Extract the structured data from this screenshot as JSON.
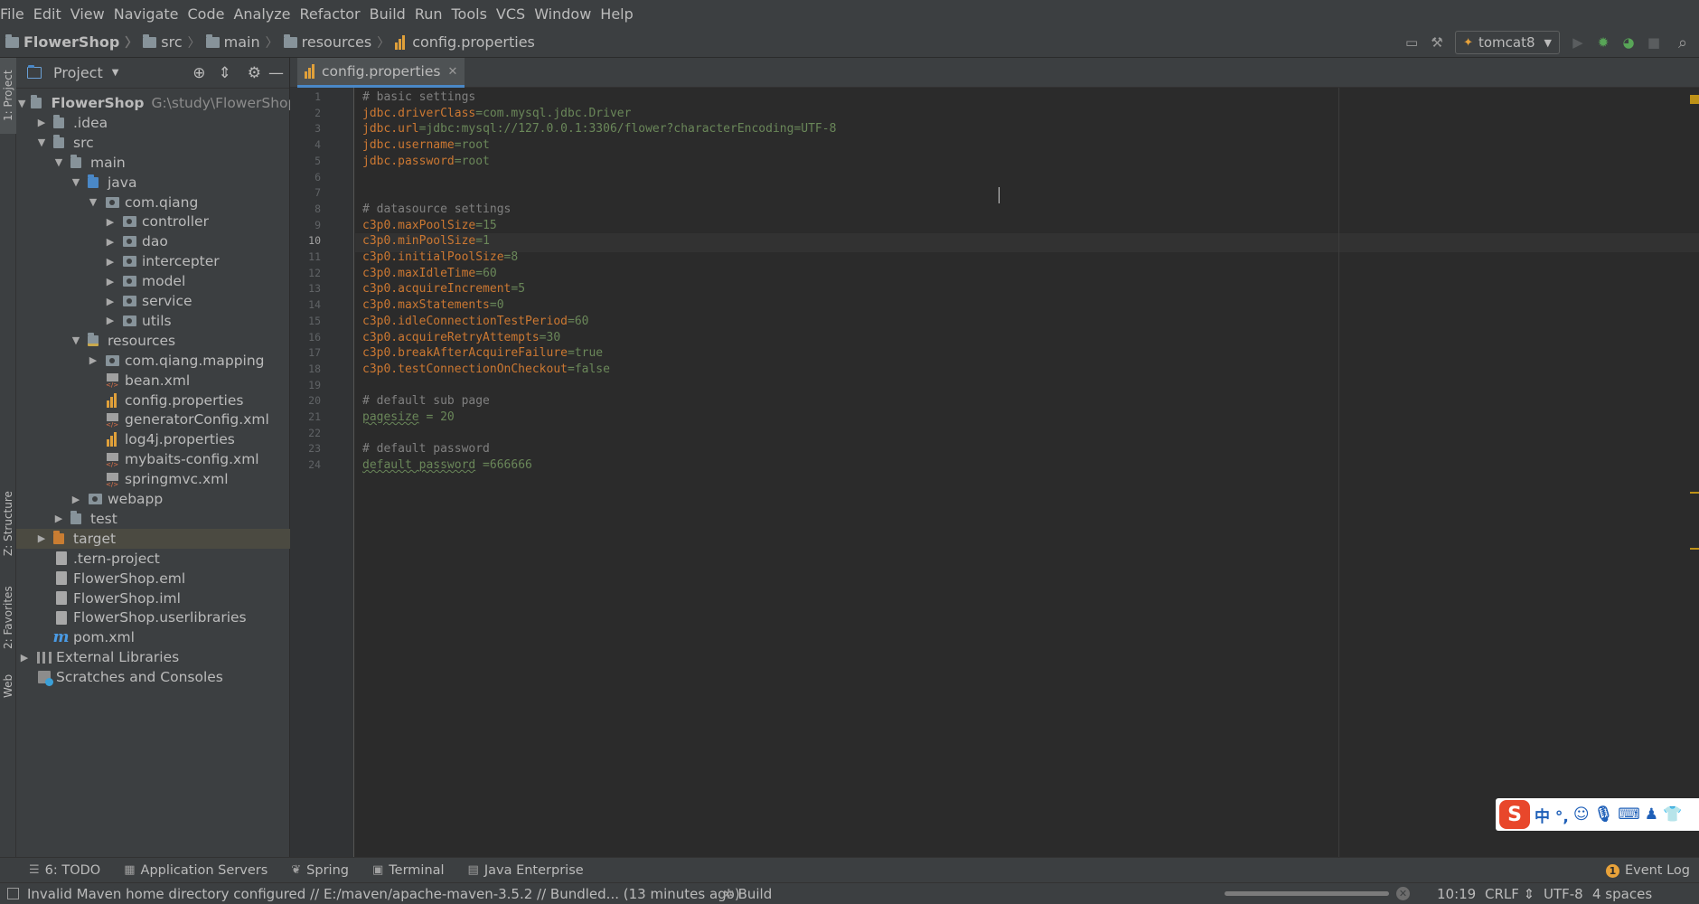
{
  "menu": [
    "File",
    "Edit",
    "View",
    "Navigate",
    "Code",
    "Analyze",
    "Refactor",
    "Build",
    "Run",
    "Tools",
    "VCS",
    "Window",
    "Help"
  ],
  "breadcrumb": [
    "FlowerShop",
    "src",
    "main",
    "resources",
    "config.properties"
  ],
  "run_config": "tomcat8",
  "project_panel": {
    "title": "Project",
    "tree": [
      {
        "label": "FlowerShop",
        "hint": "G:\\study\\FlowerShop",
        "level": 0,
        "chev": "open",
        "icon": "folder",
        "bold": true
      },
      {
        "label": ".idea",
        "level": 1,
        "chev": "closed",
        "icon": "folder"
      },
      {
        "label": "src",
        "level": 1,
        "chev": "open",
        "icon": "folder"
      },
      {
        "label": "main",
        "level": 2,
        "chev": "open",
        "icon": "folder"
      },
      {
        "label": "java",
        "level": 3,
        "chev": "open",
        "icon": "folder-blue"
      },
      {
        "label": "com.qiang",
        "level": 4,
        "chev": "open",
        "icon": "package"
      },
      {
        "label": "controller",
        "level": 5,
        "chev": "closed",
        "icon": "package"
      },
      {
        "label": "dao",
        "level": 5,
        "chev": "closed",
        "icon": "package"
      },
      {
        "label": "intercepter",
        "level": 5,
        "chev": "closed",
        "icon": "package"
      },
      {
        "label": "model",
        "level": 5,
        "chev": "closed",
        "icon": "package"
      },
      {
        "label": "service",
        "level": 5,
        "chev": "closed",
        "icon": "package"
      },
      {
        "label": "utils",
        "level": 5,
        "chev": "closed",
        "icon": "package"
      },
      {
        "label": "resources",
        "level": 3,
        "chev": "open",
        "icon": "folder-res"
      },
      {
        "label": "com.qiang.mapping",
        "level": 4,
        "chev": "closed",
        "icon": "package"
      },
      {
        "label": "bean.xml",
        "level": 4,
        "chev": "none",
        "icon": "xml"
      },
      {
        "label": "config.properties",
        "level": 4,
        "chev": "none",
        "icon": "props"
      },
      {
        "label": "generatorConfig.xml",
        "level": 4,
        "chev": "none",
        "icon": "xml"
      },
      {
        "label": "log4j.properties",
        "level": 4,
        "chev": "none",
        "icon": "props"
      },
      {
        "label": "mybaits-config.xml",
        "level": 4,
        "chev": "none",
        "icon": "xml"
      },
      {
        "label": "springmvc.xml",
        "level": 4,
        "chev": "none",
        "icon": "xml"
      },
      {
        "label": "webapp",
        "level": 3,
        "chev": "closed",
        "icon": "package"
      },
      {
        "label": "test",
        "level": 2,
        "chev": "closed",
        "icon": "folder"
      },
      {
        "label": "target",
        "level": 1,
        "chev": "closed",
        "icon": "folder-orange",
        "selected": true
      },
      {
        "label": ".tern-project",
        "level": 1,
        "chev": "none",
        "icon": "file"
      },
      {
        "label": "FlowerShop.eml",
        "level": 1,
        "chev": "none",
        "icon": "file"
      },
      {
        "label": "FlowerShop.iml",
        "level": 1,
        "chev": "none",
        "icon": "file"
      },
      {
        "label": "FlowerShop.userlibraries",
        "level": 1,
        "chev": "none",
        "icon": "file"
      },
      {
        "label": "pom.xml",
        "level": 1,
        "chev": "none",
        "icon": "maven"
      },
      {
        "label": "External Libraries",
        "level": 0,
        "chev": "closed",
        "icon": "library"
      },
      {
        "label": "Scratches and Consoles",
        "level": 0,
        "chev": "none",
        "icon": "scratch"
      }
    ]
  },
  "left_strip_tabs": [
    "1: Project",
    "Z: Structure",
    "2: Favorites",
    "Web"
  ],
  "editor": {
    "tab_label": "config.properties",
    "current_line": 10,
    "lines": [
      {
        "n": "1",
        "type": "comment",
        "text": "# basic settings"
      },
      {
        "n": "2",
        "type": "kv",
        "key": "jdbc.driverClass",
        "sep": "=",
        "val": "com.mysql.jdbc.Driver"
      },
      {
        "n": "3",
        "type": "kv",
        "key": "jdbc.url",
        "sep": "=",
        "val": "jdbc:mysql://127.0.0.1:3306/flower?characterEncoding=UTF-8"
      },
      {
        "n": "4",
        "type": "kv",
        "key": "jdbc.username",
        "sep": "=",
        "val": "root"
      },
      {
        "n": "5",
        "type": "kv",
        "key": "jdbc.password",
        "sep": "=",
        "val": "root"
      },
      {
        "n": "6",
        "type": "empty",
        "text": ""
      },
      {
        "n": "7",
        "type": "empty",
        "text": ""
      },
      {
        "n": "8",
        "type": "comment",
        "text": "# datasource settings"
      },
      {
        "n": "9",
        "type": "kv",
        "key": "c3p0.maxPoolSize",
        "sep": "=",
        "val": "15"
      },
      {
        "n": "10",
        "type": "kv",
        "key": "c3p0.minPoolSize",
        "sep": "=",
        "val": "1"
      },
      {
        "n": "11",
        "type": "kv",
        "key": "c3p0.initialPoolSize",
        "sep": "=",
        "val": "8"
      },
      {
        "n": "12",
        "type": "kv",
        "key": "c3p0.maxIdleTime",
        "sep": "=",
        "val": "60"
      },
      {
        "n": "13",
        "type": "kv",
        "key": "c3p0.acquireIncrement",
        "sep": "=",
        "val": "5"
      },
      {
        "n": "14",
        "type": "kv",
        "key": "c3p0.maxStatements",
        "sep": "=",
        "val": "0"
      },
      {
        "n": "15",
        "type": "kv",
        "key": "c3p0.idleConnectionTestPeriod",
        "sep": "=",
        "val": "60"
      },
      {
        "n": "16",
        "type": "kv",
        "key": "c3p0.acquireRetryAttempts",
        "sep": "=",
        "val": "30"
      },
      {
        "n": "17",
        "type": "kv",
        "key": "c3p0.breakAfterAcquireFailure",
        "sep": "=",
        "val": "true"
      },
      {
        "n": "18",
        "type": "kv",
        "key": "c3p0.testConnectionOnCheckout",
        "sep": "=",
        "val": "false"
      },
      {
        "n": "19",
        "type": "empty",
        "text": ""
      },
      {
        "n": "20",
        "type": "comment",
        "text": "# default sub page"
      },
      {
        "n": "21",
        "type": "warnkv",
        "key": "pagesize",
        "sep": " = ",
        "val": "20"
      },
      {
        "n": "22",
        "type": "empty",
        "text": ""
      },
      {
        "n": "23",
        "type": "comment",
        "text": "# default password"
      },
      {
        "n": "24",
        "type": "warnkv",
        "key": "default password",
        "sep": " =",
        "val": "666666"
      }
    ]
  },
  "tool_windows": [
    {
      "label": "6: TODO",
      "icon": "todo-icon",
      "glyph": "☰"
    },
    {
      "label": "Application Servers",
      "icon": "server-icon",
      "glyph": "▦"
    },
    {
      "label": "Spring",
      "icon": "spring-icon",
      "glyph": "❦"
    },
    {
      "label": "Terminal",
      "icon": "terminal-icon",
      "glyph": "▣"
    },
    {
      "label": "Java Enterprise",
      "icon": "java-enterprise-icon",
      "glyph": "▤"
    }
  ],
  "event_log": {
    "label": "Event Log",
    "count": "1"
  },
  "status": {
    "message": "Invalid Maven home directory configured // E:/maven/apache-maven-3.5.2 // Bundled... (13 minutes ago)",
    "build": "Build",
    "position": "10:19",
    "line_sep": "CRLF",
    "encoding": "UTF-8",
    "indent": "4 spaces"
  },
  "ime": {
    "text": "中 °,"
  }
}
